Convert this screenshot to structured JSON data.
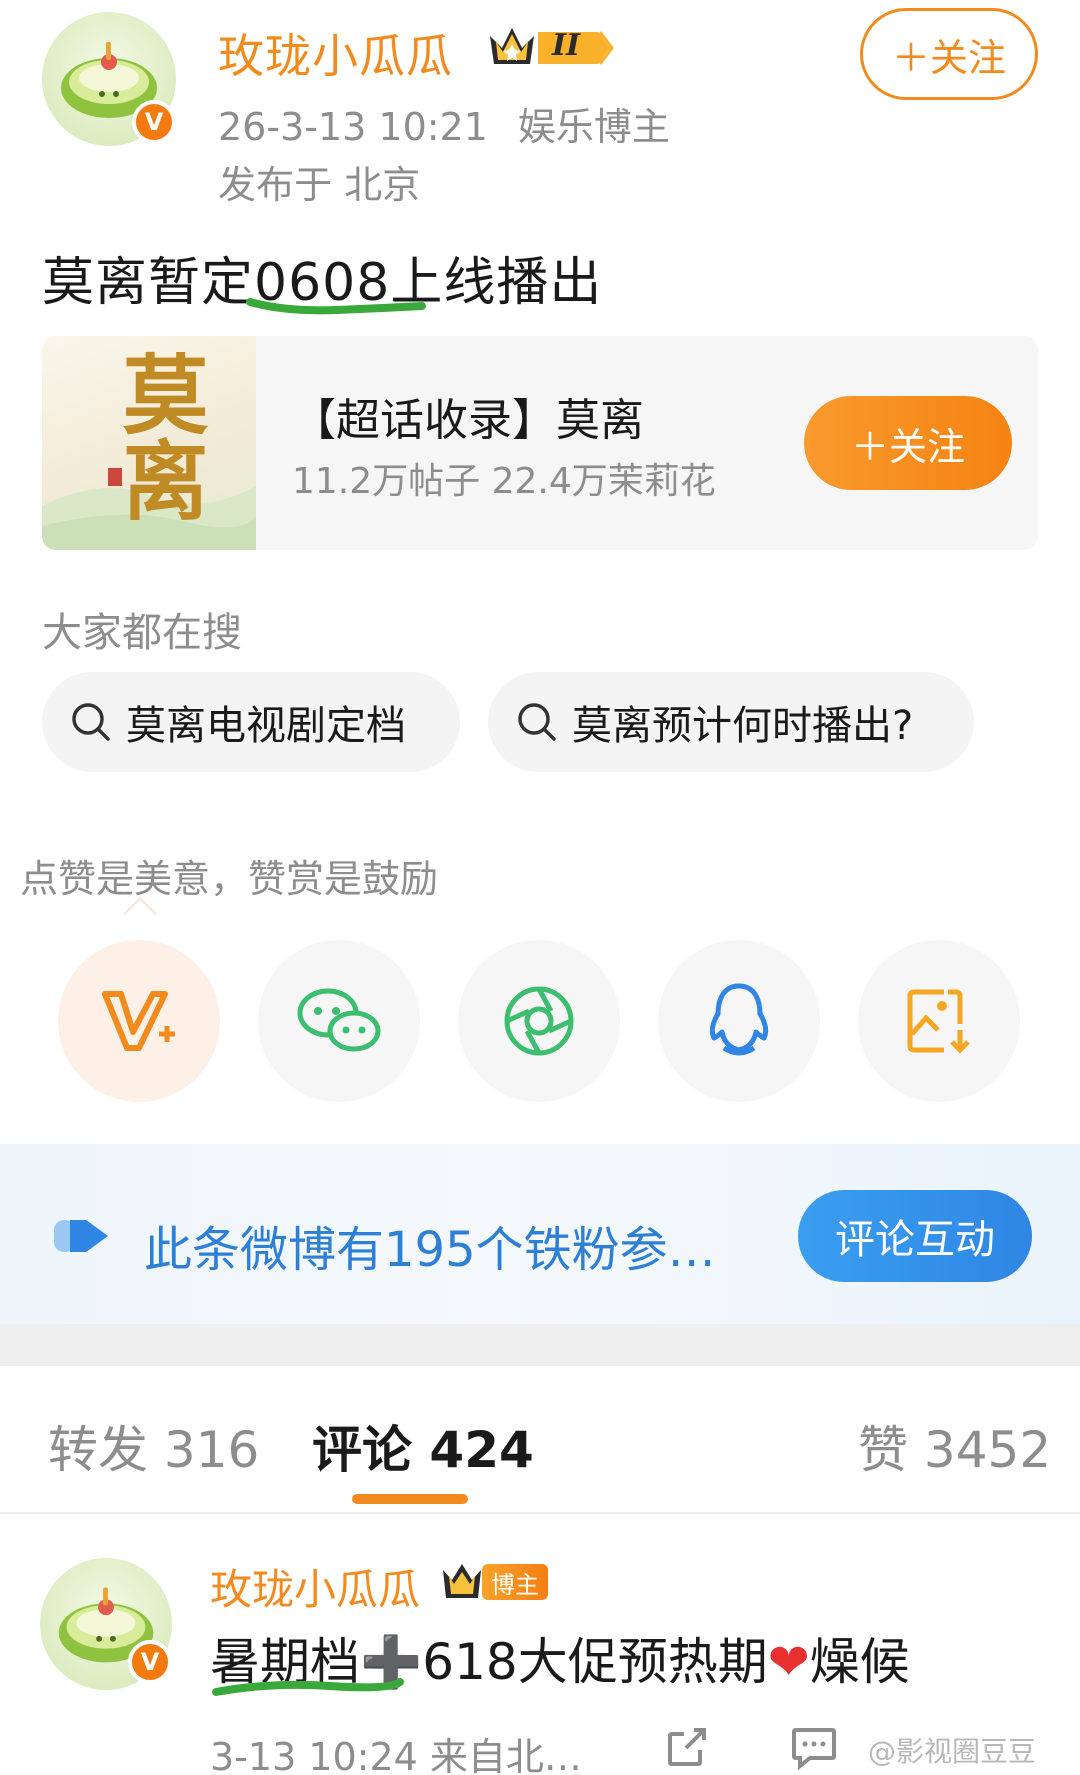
{
  "post": {
    "author_name": "玫珑小瓜瓜",
    "level_badge": "II",
    "timestamp": "26-3-13 10:21",
    "author_tag": "娱乐博主",
    "location": "发布于 北京",
    "follow_label": "＋关注",
    "text_before": "莫离暂定",
    "text_highlight": "0608上",
    "text_after": "线播出",
    "verified_mark": "V"
  },
  "topic_card": {
    "cover_text": "莫离",
    "title": "【超话收录】莫离",
    "stats": "11.2万帖子 22.4万茉莉花",
    "follow_label": "＋关注"
  },
  "search": {
    "title": "大家都在搜",
    "chips": [
      {
        "label": "莫离电视剧定档"
      },
      {
        "label": "莫离预计何时播出?"
      }
    ]
  },
  "share": {
    "reward_text": "点赞是美意，赞赏是鼓励",
    "buttons": [
      {
        "icon": "v-reward-icon",
        "color": "#f28a1e"
      },
      {
        "icon": "wechat-icon",
        "color": "#3cbd6f"
      },
      {
        "icon": "moments-icon",
        "color": "#3cbd6f"
      },
      {
        "icon": "qq-icon",
        "color": "#2f86e4"
      },
      {
        "icon": "save-image-icon",
        "color": "#f5a623"
      }
    ]
  },
  "fan_banner": {
    "text": "此条微博有195个铁粉参…",
    "button_label": "评论互动"
  },
  "tabs": {
    "repost": "转发 316",
    "comment": "评论 424",
    "like": "赞 3452"
  },
  "comment": {
    "author_name": "玫珑小瓜瓜",
    "badge_label": "博主",
    "text_part1": "暑期档",
    "text_plus": "➕",
    "text_part2": "618大促预热期",
    "text_heart": "❤",
    "text_part3": "燥候",
    "meta": "3-13 10:24 来自北…",
    "watermark": "@影视圈豆豆"
  },
  "colors": {
    "accent_orange": "#f28a1e",
    "link_blue": "#2e7fd6",
    "highlight_green": "#3aa83a"
  }
}
